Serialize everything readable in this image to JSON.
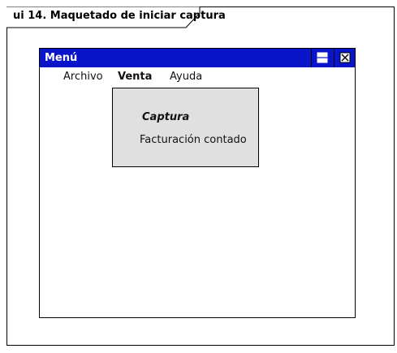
{
  "diagram": {
    "frame_title": "ui 14. Maquetado de iniciar captura"
  },
  "window": {
    "title": "Menú",
    "buttons": {
      "maximize_icon": "maximize-icon",
      "close_icon": "close-icon"
    },
    "title_bar_color": "#0a14c8"
  },
  "menu": {
    "items": [
      "Archivo",
      "Venta",
      "Ayuda"
    ],
    "active": "Venta"
  },
  "dropdown": {
    "header": "Captura",
    "items": [
      "Facturación contado"
    ]
  }
}
